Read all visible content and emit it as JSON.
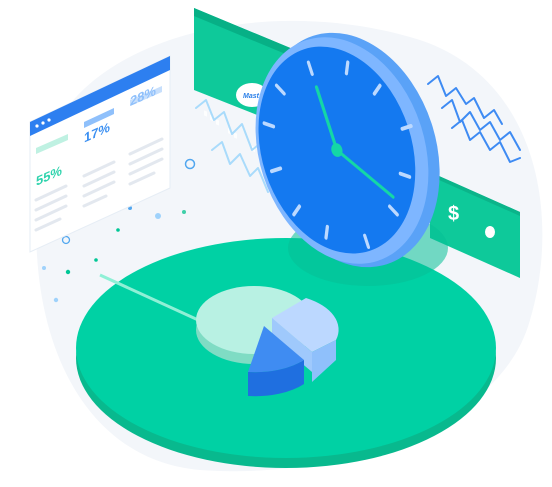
{
  "colors": {
    "background_blob": "#f3f6fa",
    "platform_top": "#00d1a4",
    "platform_side": "#08b98e",
    "clock_face": "#1479f0",
    "clock_rim": "#7eb6ff",
    "card_green": "#0ec99a",
    "accent_blue": "#3e8bf3"
  },
  "dashboard": {
    "stats": [
      {
        "value": "55%",
        "color": "#2fd3ad"
      },
      {
        "value": "17%",
        "color": "#3a8ff2"
      },
      {
        "value": "28%",
        "color": "#8fc0fb"
      }
    ]
  },
  "credit_card": {
    "brand": "Mast"
  },
  "banknote": {
    "symbol": "$"
  },
  "clock": {
    "hour_hand": "12",
    "minute_hand": "5"
  },
  "pie": {
    "shares": [
      55,
      17,
      28
    ]
  },
  "icons": [
    "clock-icon",
    "pie-chart-icon",
    "credit-card-icon",
    "banknote-icon",
    "dashboard-window-icon"
  ]
}
